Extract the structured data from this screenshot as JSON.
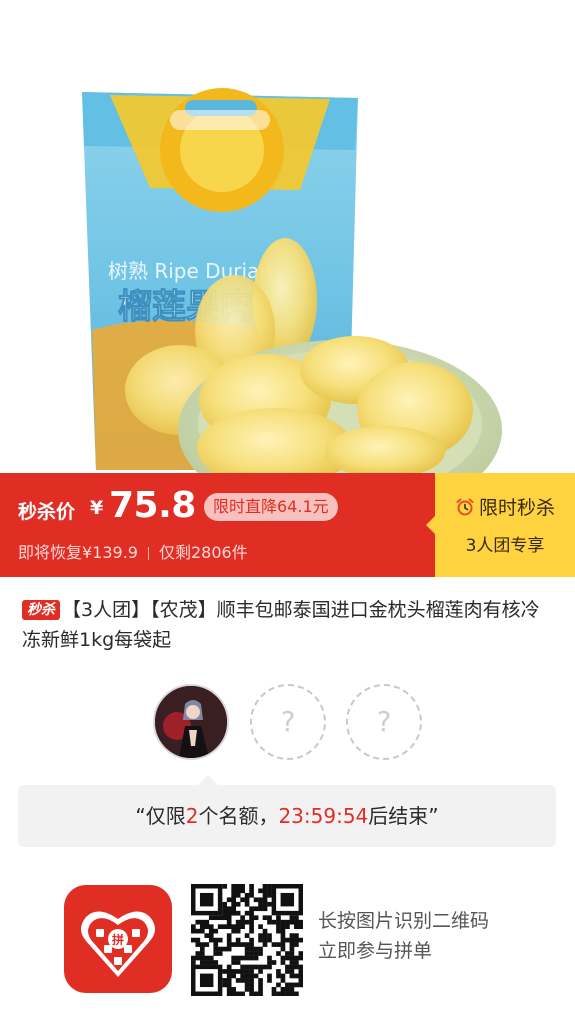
{
  "product_image": {
    "alt_icon": "durian-product-photo"
  },
  "price_bar": {
    "label": "秒杀价",
    "currency": "¥",
    "price": "75.8",
    "drop_badge": "限时直降64.1元",
    "restore_text": "即将恢复¥139.9",
    "stock_text": "仅剩2806件",
    "flash_label": "限时秒杀",
    "group_label": "3人团专享",
    "colors": {
      "accent": "#e02e24",
      "flash_bg": "#ffd23f"
    }
  },
  "title": {
    "tag": "秒杀",
    "text": "【3人团】【农茂】顺丰包邮泰国进口金枕头榴莲肉有核冷冻新鲜1kg每袋起"
  },
  "group": {
    "slots_total": 3,
    "slots_filled": 1,
    "empty_mark": "?",
    "message_prefix": "“仅限",
    "slots_left": "2",
    "message_mid": "个名额，",
    "countdown": "23:59:54",
    "message_suffix": "后结束”"
  },
  "footer": {
    "logo_char": "拼",
    "scan_line1": "长按图片识别二维码",
    "scan_line2": "立即参与拼单"
  }
}
